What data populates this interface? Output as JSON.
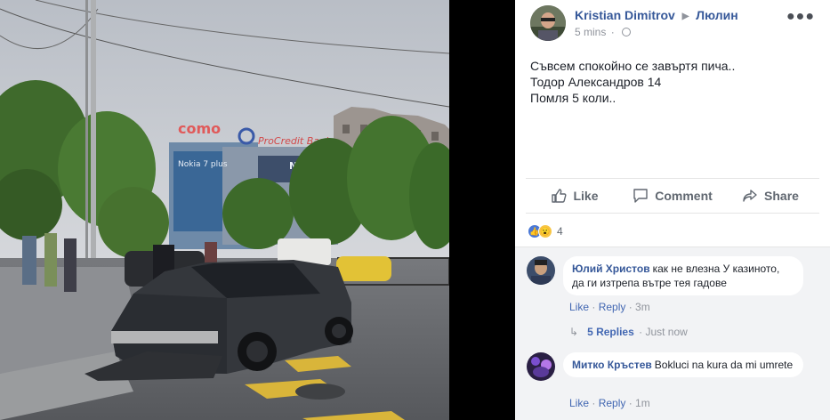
{
  "post": {
    "author": "Kristian Dimitrov",
    "location": "Люлин",
    "time": "5 mins",
    "privacy_icon": "globe-icon",
    "more_icon": "ellipsis-icon",
    "text_lines": [
      "Съвсем спокойно се завъртя пича..",
      "Тодор Александров 14",
      "Помля 5 коли.."
    ],
    "photo": {
      "signs": [
        "como",
        "ProCredit Bank",
        "Nokia 7 plus",
        "NOKIA"
      ]
    }
  },
  "actions": {
    "like": "Like",
    "comment": "Comment",
    "share": "Share"
  },
  "reactions": {
    "types": [
      "like",
      "wow"
    ],
    "count": "4"
  },
  "comments": [
    {
      "name": "Юлий Христов",
      "text": "как не влезна У казиното, да ги изтрепа вътре тея гадове",
      "like": "Like",
      "reply": "Reply",
      "time": "3m",
      "replies_label": "5 Replies",
      "replies_time": "Just now"
    },
    {
      "name": "Митко Кръстев",
      "text": "Bokluci na kura da mi umrete",
      "like": "Like",
      "reply": "Reply",
      "time": "1m"
    }
  ],
  "colors": {
    "link": "#365899",
    "muted": "#90949c",
    "like_blue": "#4a78d6",
    "comments_bg": "#f2f3f5"
  }
}
